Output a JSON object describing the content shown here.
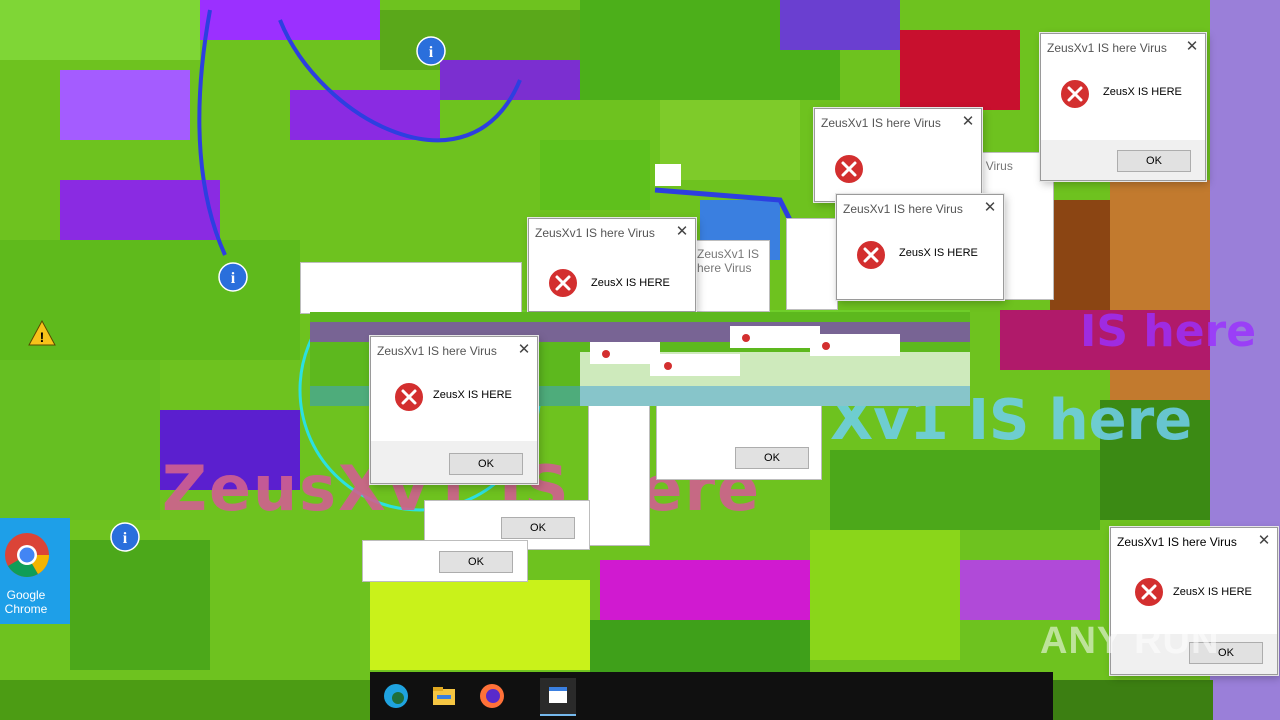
{
  "dialog": {
    "title": "ZeusXv1 IS here Virus",
    "message": "ZeusX IS HERE",
    "ok_label": "OK",
    "close_label": "✕"
  },
  "background_text": {
    "large_overlay": "ZeusXv1 IS here",
    "large_overlay_2": "Xv1 IS here",
    "large_overlay_3": "IS here"
  },
  "desktop": {
    "chrome_label": "Google Chrome"
  },
  "watermark": "ANY RUN",
  "colors": {
    "accent_error": "#d32f2f",
    "glitch_green": "#6ec21f",
    "glitch_purple": "#8a2be2",
    "taskbar": "#101010"
  },
  "icons": [
    "error-icon",
    "info-icon",
    "warning-icon",
    "chrome-icon",
    "edge-icon",
    "file-explorer-icon",
    "firefox-icon",
    "close-icon"
  ]
}
